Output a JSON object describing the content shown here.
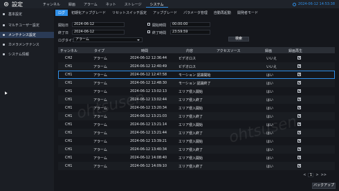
{
  "app": {
    "title": "設定",
    "icon": "gear-icon"
  },
  "topnav": [
    "チャンネル",
    "録画",
    "アラーム",
    "ネット",
    "ストレージ",
    "システム"
  ],
  "topnav_active": 5,
  "clock": "2024-06-12 14:53:38",
  "sidebar": [
    {
      "label": "基本設定"
    },
    {
      "label": "マルチユーザー設定"
    },
    {
      "label": "メンテナンス設定"
    },
    {
      "label": "カメラメンテナンス"
    },
    {
      "label": "システム情報"
    }
  ],
  "sidebar_active": 2,
  "subtabs": [
    "ログ",
    "初期化アップグレード",
    "リセットスイッチ設定",
    "アップグレード",
    "パラメータ管理",
    "自動再起動",
    "開発者モード"
  ],
  "subtab_active": 0,
  "filters": {
    "start_date_label": "開始日",
    "start_date": "2024-06-12",
    "end_date_label": "終了日",
    "end_date": "2024-06-12",
    "start_time_label": "開始時間",
    "start_time": "00:00:00",
    "end_time_label": "終了時間",
    "end_time": "23:59:59",
    "log_type_label": "ログタイプ",
    "log_type": "アラーム",
    "search_label": "検索"
  },
  "table": {
    "headers": [
      "チャンネル",
      "タイプ",
      "時間",
      "内容",
      "アクセスソース",
      "録画",
      "録画再生"
    ],
    "rows": [
      [
        "CH2",
        "アラーム",
        "2024-06-12 12:36:44",
        "ビデオロス",
        "",
        "いいえ"
      ],
      [
        "CH1",
        "アラーム",
        "2024-06-12 12:40:49",
        "ビデオロス",
        "",
        "いいえ"
      ],
      [
        "CH1",
        "アラーム",
        "2024-06-12 12:47:58",
        "モーション 認識開始",
        "",
        "はい"
      ],
      [
        "CH1",
        "アラーム",
        "2024-06-12 12:48:30",
        "モーション 認識終了",
        "",
        "はい"
      ],
      [
        "CH1",
        "アラーム",
        "2024-06-12 13:02:13",
        "エリア侵入開始",
        "",
        "はい"
      ],
      [
        "CH1",
        "アラーム",
        "2024-06-12 13:02:44",
        "エリア侵入終了",
        "",
        "はい"
      ],
      [
        "CH1",
        "アラーム",
        "2024-06-12 13:20:34",
        "エリア侵入開始",
        "",
        "はい"
      ],
      [
        "CH1",
        "アラーム",
        "2024-06-12 13:21:03",
        "エリア侵入終了",
        "",
        "はい"
      ],
      [
        "CH1",
        "アラーム",
        "2024-06-12 13:21:14",
        "エリア侵入開始",
        "",
        "はい"
      ],
      [
        "CH1",
        "アラーム",
        "2024-06-12 13:21:44",
        "エリア侵入終了",
        "",
        "はい"
      ],
      [
        "CH1",
        "アラーム",
        "2024-06-12 13:39:21",
        "エリア侵入開始",
        "",
        "はい"
      ],
      [
        "CH1",
        "アラーム",
        "2024-06-12 13:40:34",
        "エリア侵入終了",
        "",
        "はい"
      ],
      [
        "CH1",
        "アラーム",
        "2024-06-12 14:08:40",
        "エリア侵入開始",
        "",
        "はい"
      ],
      [
        "CH1",
        "アラーム",
        "2024-06-12 14:09:10",
        "エリア侵入終了",
        "",
        "はい"
      ]
    ],
    "selected_row": 2
  },
  "pager": {
    "prev": "<",
    "page": "1",
    "next": ">",
    "last": ">>"
  },
  "backup_label": "バックアップ",
  "watermark": "ohtsusen",
  "colors": {
    "accent": "#2f8ee6",
    "background": "#15171c"
  }
}
